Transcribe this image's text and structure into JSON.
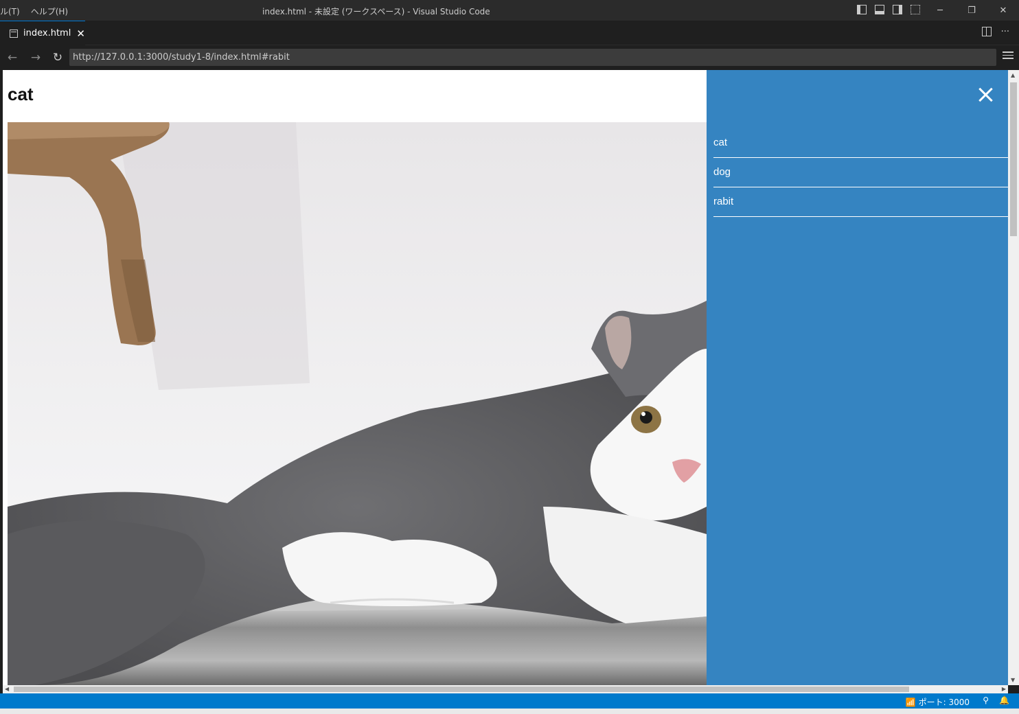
{
  "window": {
    "menu": [
      "ル(T)",
      "ヘルプ(H)"
    ],
    "title": "index.html - 未設定 (ワークスペース) - Visual Studio Code"
  },
  "editor": {
    "tab_label": "index.html",
    "tab_close": "✕"
  },
  "browser": {
    "back": "←",
    "forward": "→",
    "reload": "↻",
    "url": "http://127.0.0.1:3000/study1-8/index.html#rabit"
  },
  "page": {
    "heading": "cat",
    "menu_items": [
      "cat",
      "dog",
      "rabit"
    ]
  },
  "status": {
    "port_label": "ポート: 3000"
  },
  "colors": {
    "drawer": "#3584c1",
    "statusbar": "#007acc",
    "titlebar": "#2b2b2b"
  }
}
